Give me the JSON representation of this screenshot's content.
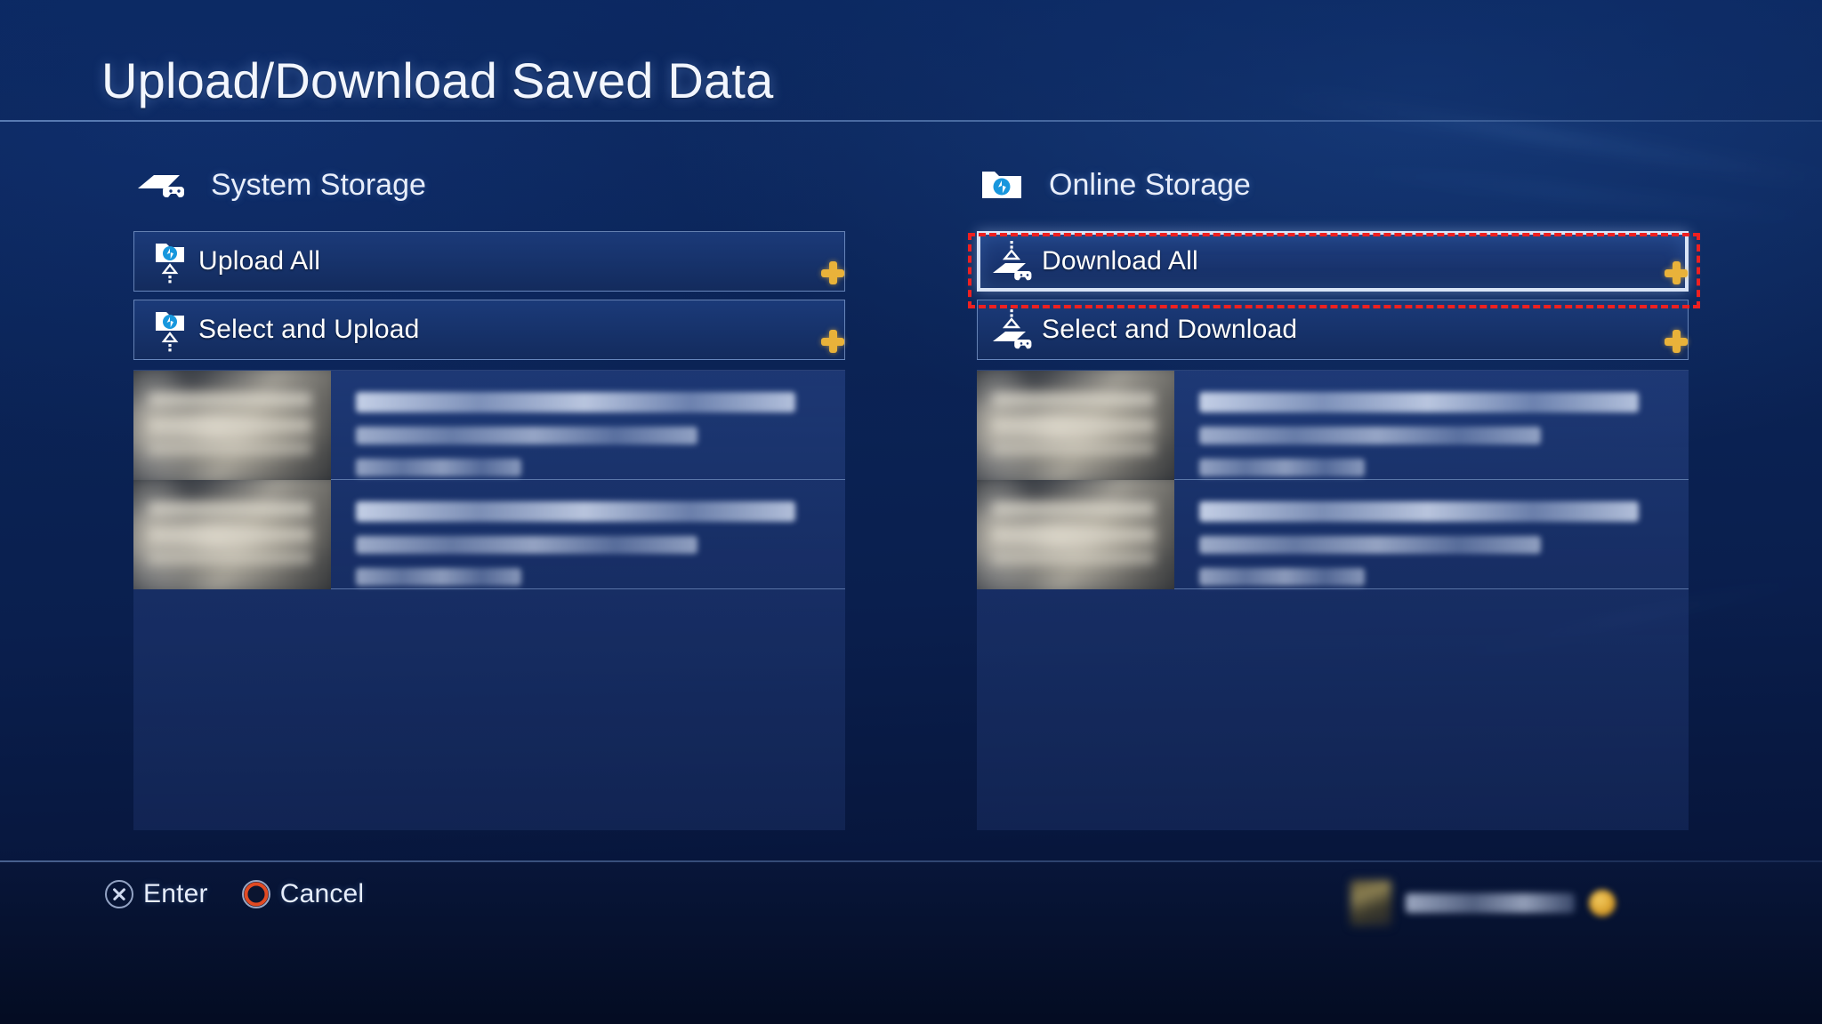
{
  "page": {
    "title": "Upload/Download Saved Data"
  },
  "colors": {
    "background": "#0b2457",
    "panel": "#17336c",
    "row_border": "#a8c7f5",
    "selected_border": "#d9e4f6",
    "ps_plus_gold": "#e9b23a",
    "annotation_red": "#ef2020",
    "circle_button_red": "#e24a22",
    "text_primary": "#ffffff"
  },
  "columns": [
    {
      "id": "system-storage",
      "heading": "System Storage",
      "icon": "ps4-console-controller-icon",
      "actions": [
        {
          "id": "upload-all",
          "label": "Upload All",
          "icon": "folder-upload-icon",
          "badge": "ps-plus-badge",
          "selected": false
        },
        {
          "id": "select-and-upload",
          "label": "Select and Upload",
          "icon": "folder-upload-icon",
          "badge": "ps-plus-badge",
          "selected": false
        }
      ],
      "saved_data": [
        {
          "id": "system-save-1",
          "title_blurred": true,
          "thumbnail": "blurred-game-thumbnail",
          "lines": 3
        },
        {
          "id": "system-save-2",
          "title_blurred": true,
          "thumbnail": "blurred-game-thumbnail",
          "lines": 3
        }
      ]
    },
    {
      "id": "online-storage",
      "heading": "Online Storage",
      "icon": "folder-playstation-icon",
      "actions": [
        {
          "id": "download-all",
          "label": "Download All",
          "icon": "console-download-icon",
          "badge": "ps-plus-badge",
          "selected": true
        },
        {
          "id": "select-and-download",
          "label": "Select and Download",
          "icon": "console-download-icon",
          "badge": "ps-plus-badge",
          "selected": false
        }
      ],
      "saved_data": [
        {
          "id": "online-save-1",
          "title_blurred": true,
          "thumbnail": "blurred-game-thumbnail",
          "lines": 3
        },
        {
          "id": "online-save-2",
          "title_blurred": true,
          "thumbnail": "blurred-game-thumbnail",
          "lines": 3
        }
      ]
    }
  ],
  "annotation": {
    "id": "download-all-highlight",
    "style": "red-dashed-rectangle",
    "targets": "download-all"
  },
  "footer": {
    "hints": [
      {
        "id": "enter",
        "button": "cross-button-icon",
        "label": "Enter"
      },
      {
        "id": "cancel",
        "button": "circle-button-icon",
        "label": "Cancel"
      }
    ],
    "user": {
      "avatar": "blurred-user-avatar",
      "name_blurred": true,
      "badge": "ps-plus-gold-badge"
    }
  }
}
